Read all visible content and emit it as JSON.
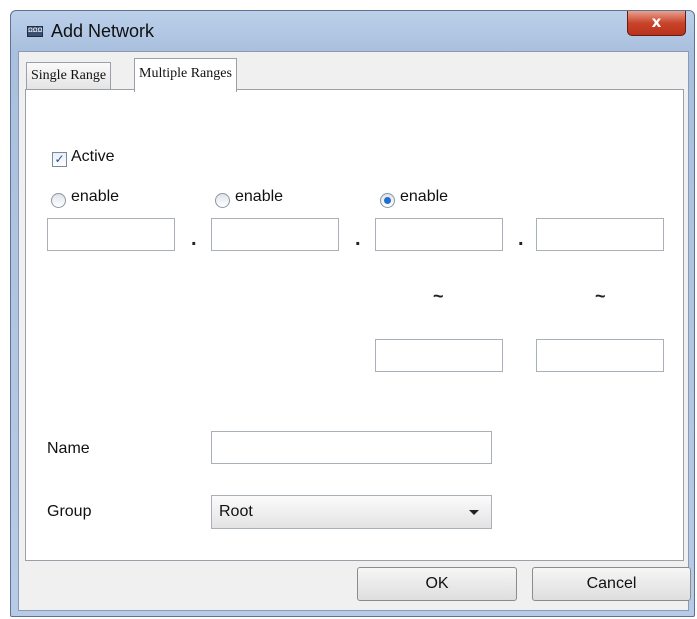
{
  "window": {
    "title": "Add Network",
    "app_icon_text": "ΩΩΩ",
    "close_glyph": "x"
  },
  "tabs": [
    {
      "label": "Single Range",
      "active": false
    },
    {
      "label": "Multiple Ranges",
      "active": true
    }
  ],
  "form": {
    "active": {
      "label": "Active",
      "checked": true
    },
    "enable_options": [
      {
        "label": "enable",
        "selected": false
      },
      {
        "label": "enable",
        "selected": false
      },
      {
        "label": "enable",
        "selected": true
      }
    ],
    "separator": ".",
    "range_symbol": "~",
    "octets": [
      "",
      "",
      "",
      ""
    ],
    "range_end_octets": [
      "",
      ""
    ],
    "name": {
      "label": "Name",
      "value": ""
    },
    "group": {
      "label": "Group",
      "selected": "Root"
    }
  },
  "buttons": {
    "ok": "OK",
    "cancel": "Cancel"
  },
  "colors": {
    "title_bar": "#a9c0de",
    "close_button": "#c9442a",
    "radio_selected": "#1f6fd0"
  }
}
